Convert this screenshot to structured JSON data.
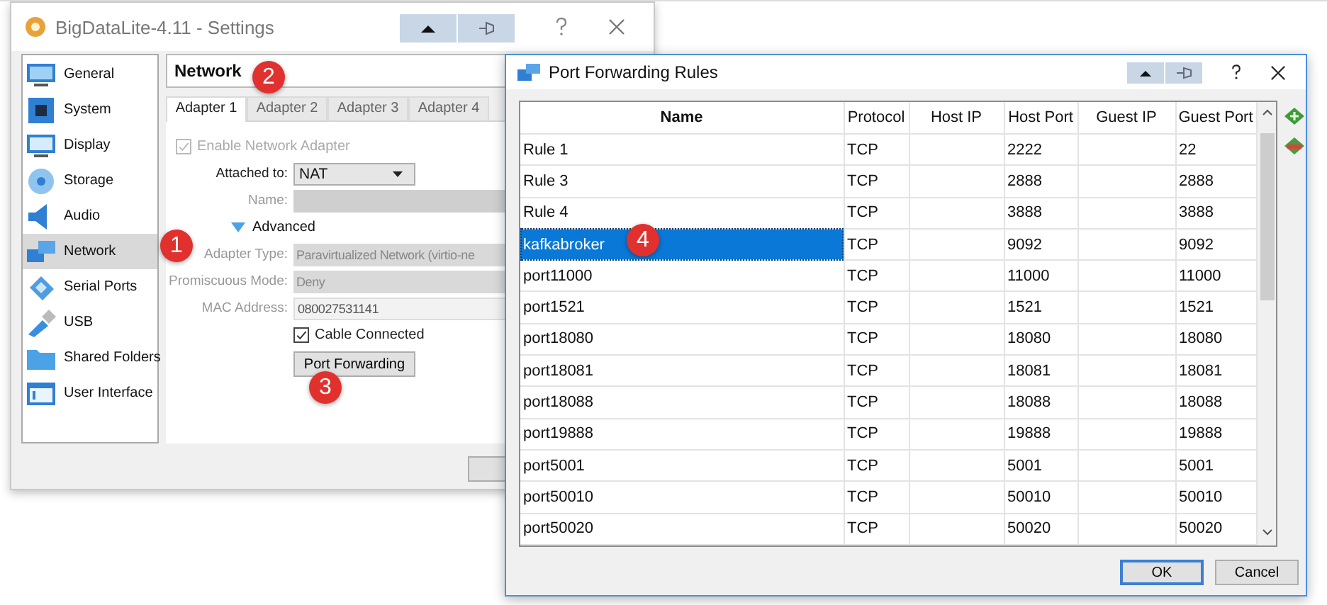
{
  "settings_window": {
    "title": "BigDataLite-4.11 - Settings",
    "sidebar": {
      "items": [
        {
          "label": "General",
          "selected": false
        },
        {
          "label": "System",
          "selected": false
        },
        {
          "label": "Display",
          "selected": false
        },
        {
          "label": "Storage",
          "selected": false
        },
        {
          "label": "Audio",
          "selected": false
        },
        {
          "label": "Network",
          "selected": true
        },
        {
          "label": "Serial Ports",
          "selected": false
        },
        {
          "label": "USB",
          "selected": false
        },
        {
          "label": "Shared Folders",
          "selected": false
        },
        {
          "label": "User Interface",
          "selected": false
        }
      ]
    },
    "section_title": "Network",
    "tabs": [
      {
        "label": "Adapter 1",
        "selected": true
      },
      {
        "label": "Adapter 2",
        "selected": false
      },
      {
        "label": "Adapter 3",
        "selected": false
      },
      {
        "label": "Adapter 4",
        "selected": false
      }
    ],
    "form": {
      "enable_adapter": {
        "label": "Enable Network Adapter",
        "checked": true,
        "disabled": true
      },
      "attached_to": {
        "label": "Attached to:",
        "value": "NAT",
        "disabled": false
      },
      "name": {
        "label": "Name:",
        "disabled": true
      },
      "advanced": {
        "label": "Advanced",
        "expanded": true
      },
      "adapter_type": {
        "label": "Adapter Type:",
        "value": "Paravirtualized Network (virtio-ne",
        "disabled": true
      },
      "promiscuous_mode": {
        "label": "Promiscuous Mode:",
        "value": "Deny",
        "disabled": true
      },
      "mac_address": {
        "label": "MAC Address:",
        "value": "080027531141",
        "disabled": true
      },
      "cable_connected": {
        "label": "Cable Connected",
        "checked": true,
        "disabled": false
      },
      "port_forwarding_button": "Port Forwarding"
    }
  },
  "port_forwarding_dialog": {
    "title": "Port Forwarding Rules",
    "table": {
      "columns": [
        "Name",
        "Protocol",
        "Host IP",
        "Host Port",
        "Guest IP",
        "Guest Port"
      ],
      "rows": [
        {
          "cells": [
            "Rule 1",
            "TCP",
            "",
            "2222",
            "",
            "22"
          ],
          "selected": false
        },
        {
          "cells": [
            "Rule 3",
            "TCP",
            "",
            "2888",
            "",
            "2888"
          ],
          "selected": false
        },
        {
          "cells": [
            "Rule 4",
            "TCP",
            "",
            "3888",
            "",
            "3888"
          ],
          "selected": false
        },
        {
          "cells": [
            "kafkabroker",
            "TCP",
            "",
            "9092",
            "",
            "9092"
          ],
          "selected": true
        },
        {
          "cells": [
            "port11000",
            "TCP",
            "",
            "11000",
            "",
            "11000"
          ],
          "selected": false
        },
        {
          "cells": [
            "port1521",
            "TCP",
            "",
            "1521",
            "",
            "1521"
          ],
          "selected": false
        },
        {
          "cells": [
            "port18080",
            "TCP",
            "",
            "18080",
            "",
            "18080"
          ],
          "selected": false
        },
        {
          "cells": [
            "port18081",
            "TCP",
            "",
            "18081",
            "",
            "18081"
          ],
          "selected": false
        },
        {
          "cells": [
            "port18088",
            "TCP",
            "",
            "18088",
            "",
            "18088"
          ],
          "selected": false
        },
        {
          "cells": [
            "port19888",
            "TCP",
            "",
            "19888",
            "",
            "19888"
          ],
          "selected": false
        },
        {
          "cells": [
            "port5001",
            "TCP",
            "",
            "5001",
            "",
            "5001"
          ],
          "selected": false
        },
        {
          "cells": [
            "port50010",
            "TCP",
            "",
            "50010",
            "",
            "50010"
          ],
          "selected": false
        },
        {
          "cells": [
            "port50020",
            "TCP",
            "",
            "50020",
            "",
            "50020"
          ],
          "selected": false
        }
      ]
    },
    "buttons": [
      {
        "label": "OK",
        "default": true
      },
      {
        "label": "Cancel",
        "default": false
      }
    ]
  },
  "callouts": [
    {
      "label": "1"
    },
    {
      "label": "2"
    },
    {
      "label": "3"
    },
    {
      "label": "4"
    }
  ]
}
